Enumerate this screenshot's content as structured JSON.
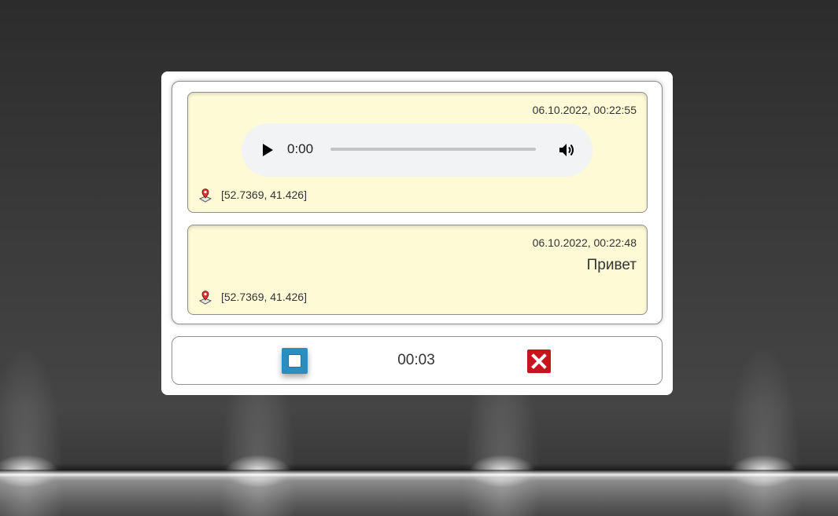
{
  "messages": [
    {
      "type": "audio",
      "date": "06.10.2022, 00:22:55",
      "audio": {
        "time": "0:00"
      },
      "coords": "[52.7369, 41.426]"
    },
    {
      "type": "text",
      "date": "06.10.2022, 00:22:48",
      "text": "Привет",
      "coords": "[52.7369, 41.426]"
    }
  ],
  "recorder": {
    "timer": "00:03",
    "stop_icon": "stop-icon",
    "cancel_icon": "close-icon"
  },
  "colors": {
    "message_background": "#fffad6",
    "stop_button": "#2a8fc0",
    "cancel_button": "#c8141c"
  }
}
